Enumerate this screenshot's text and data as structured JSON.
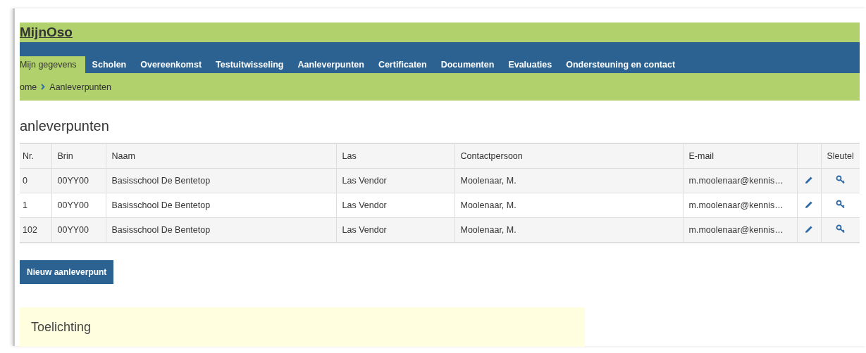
{
  "header": {
    "title": "MijnOso"
  },
  "nav": {
    "tabs": [
      {
        "label": "Mijn gegevens",
        "selected": true
      },
      {
        "label": "Scholen",
        "selected": false
      },
      {
        "label": "Overeenkomst",
        "selected": false
      },
      {
        "label": "Testuitwisseling",
        "selected": false
      },
      {
        "label": "Aanleverpunten",
        "selected": false
      },
      {
        "label": "Certificaten",
        "selected": false
      },
      {
        "label": "Documenten",
        "selected": false
      },
      {
        "label": "Evaluaties",
        "selected": false
      },
      {
        "label": "Ondersteuning en contact",
        "selected": false
      }
    ]
  },
  "breadcrumb": [
    "ome",
    "Aanleverpunten"
  ],
  "heading": "anleverpunten",
  "table": {
    "columns": [
      "Nr.",
      "Brin",
      "Naam",
      "Las",
      "Contactpersoon",
      "E-mail",
      "Sleutel"
    ],
    "rows": [
      {
        "nr": "0",
        "brin": "00YY00",
        "naam": "Basisschool De Bentetop",
        "las": "Las Vendor",
        "contact": "Moolenaar, M.",
        "email": "m.moolenaar@kennis…"
      },
      {
        "nr": "1",
        "brin": "00YY00",
        "naam": "Basisschool De Bentetop",
        "las": "Las Vendor",
        "contact": "Moolenaar, M.",
        "email": "m.moolenaar@kennis…"
      },
      {
        "nr": "102",
        "brin": "00YY00",
        "naam": "Basisschool De Bentetop",
        "las": "Las Vendor",
        "contact": "Moolenaar, M.",
        "email": "m.moolenaar@kennis…"
      }
    ]
  },
  "button": "Nieuw aanleverpunt",
  "note": {
    "title": "Toelichting"
  }
}
